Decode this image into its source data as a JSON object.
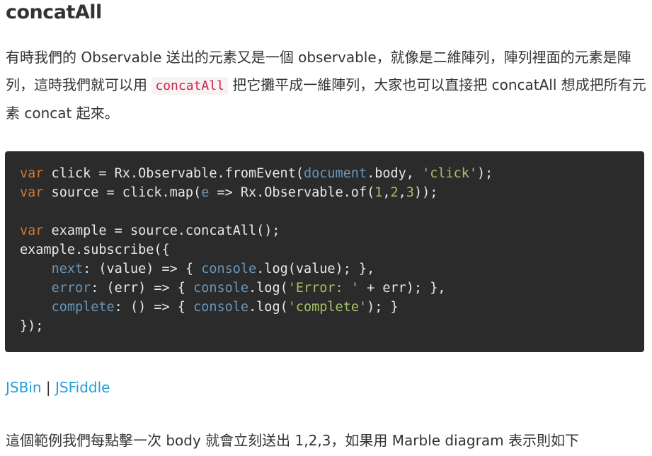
{
  "heading": "concatAll",
  "intro": {
    "part1": "有時我們的 Observable 送出的元素又是一個 observable，就像是二維陣列，陣列裡面的元素是陣列，這時我們就可以用 ",
    "code": "concatAll",
    "part2": " 把它攤平成一維陣列，大家也可以直接把 concatAll 想成把所有元素 concat 起來。"
  },
  "code": {
    "line1": {
      "kw": "var",
      "a": " click = Rx.Observable.fromEvent(",
      "doc": "document",
      "b": ".body, ",
      "str": "'click'",
      "c": ");"
    },
    "line2": {
      "kw": "var",
      "a": " source = click.map(",
      "e": "e",
      "b": " => Rx.Observable.of(",
      "n1": "1",
      "n2": "2",
      "n3": "3",
      "c": "));"
    },
    "line4": {
      "kw": "var",
      "a": " example = source.concatAll();"
    },
    "line5": {
      "a": "example.subscribe({"
    },
    "line6": {
      "key": "next",
      "a": ": (value) => { ",
      "console": "console",
      "b": ".log(value); },"
    },
    "line7": {
      "key": "error",
      "a": ": (err) => { ",
      "console": "console",
      "b": ".log(",
      "str": "'Error: '",
      "c": " + err); },"
    },
    "line8": {
      "key": "complete",
      "a": ": () => { ",
      "console": "console",
      "b": ".log(",
      "str": "'complete'",
      "c": "); }"
    },
    "line9": {
      "a": "});"
    }
  },
  "links": {
    "jsbin": "JSBin",
    "separator": "|",
    "jsfiddle": "JSFiddle"
  },
  "outro": "這個範例我們每點擊一次 body 就會立刻送出 1,2,3，如果用 Marble diagram 表示則如下"
}
